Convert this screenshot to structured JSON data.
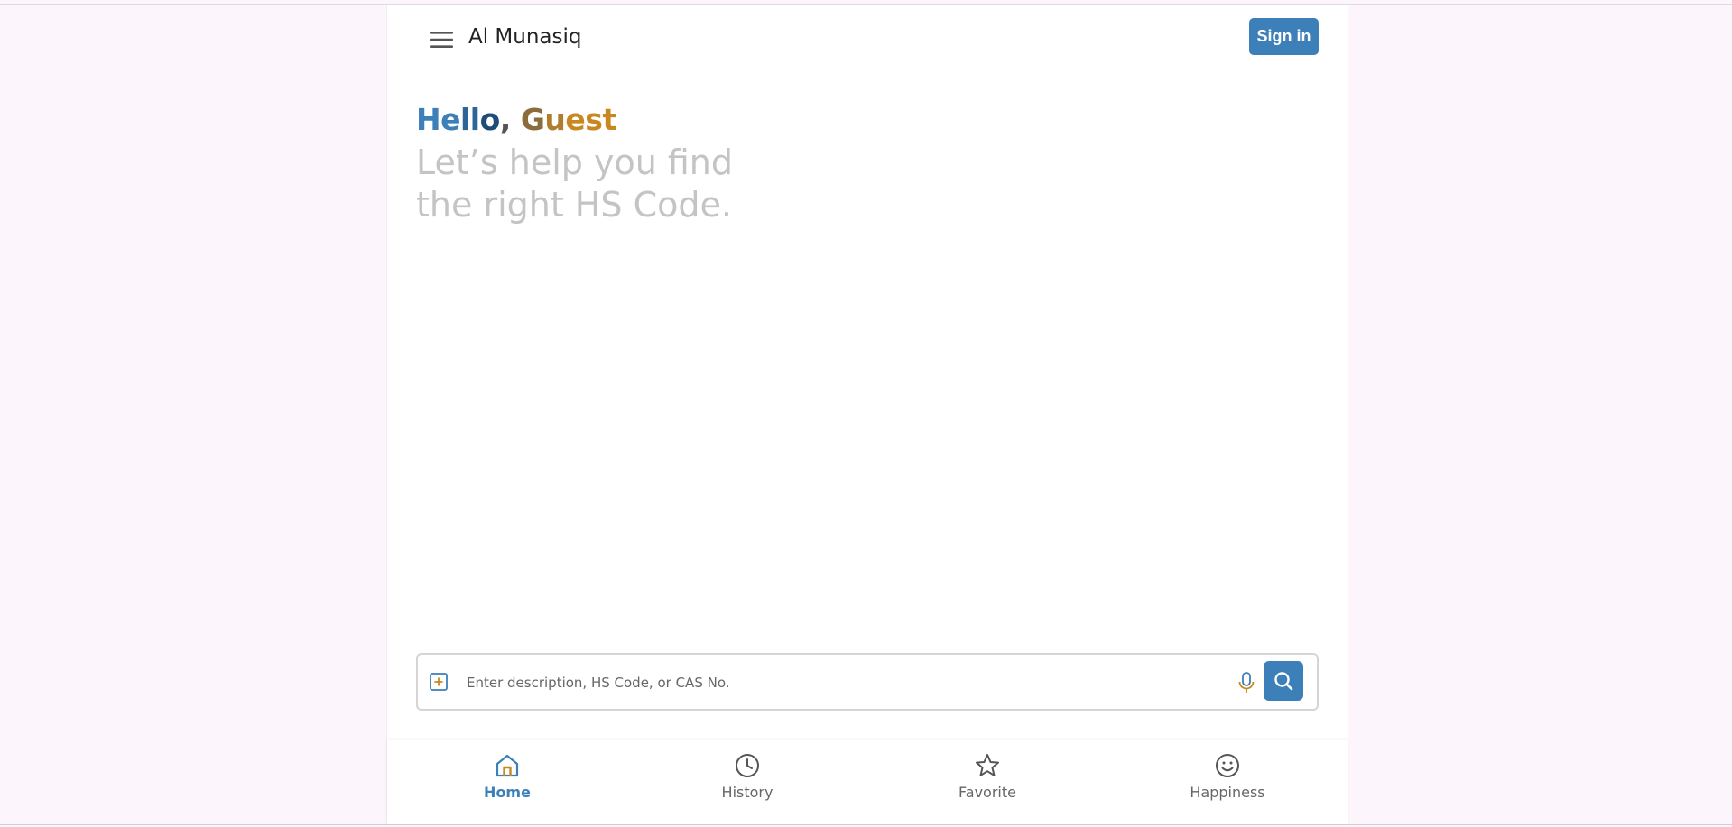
{
  "header": {
    "app_title": "Al Munasiq",
    "signin_label": "Sign in"
  },
  "greeting": {
    "parts": [
      "He",
      "ll",
      "o",
      ",",
      " G",
      "u",
      "est"
    ],
    "colors": [
      "#3d7fb8",
      "#2d6598",
      "#1f4d7a",
      "#555555",
      "#8a6d3b",
      "#b07d2e",
      "#c8881f"
    ]
  },
  "tagline": {
    "line1": "Let’s help you find",
    "line2": "the right HS Code."
  },
  "search": {
    "placeholder": "Enter description, HS Code, or CAS No.",
    "value": ""
  },
  "nav": {
    "items": [
      {
        "label": "Home",
        "icon": "home-icon",
        "active": true
      },
      {
        "label": "History",
        "icon": "clock-icon",
        "active": false
      },
      {
        "label": "Favorite",
        "icon": "star-icon",
        "active": false
      },
      {
        "label": "Happiness",
        "icon": "smiley-icon",
        "active": false
      }
    ]
  },
  "colors": {
    "accent": "#3d7fb8",
    "background": "#fcf5fc",
    "tagline": "#c4c4c4",
    "gold": "#c8881f"
  }
}
